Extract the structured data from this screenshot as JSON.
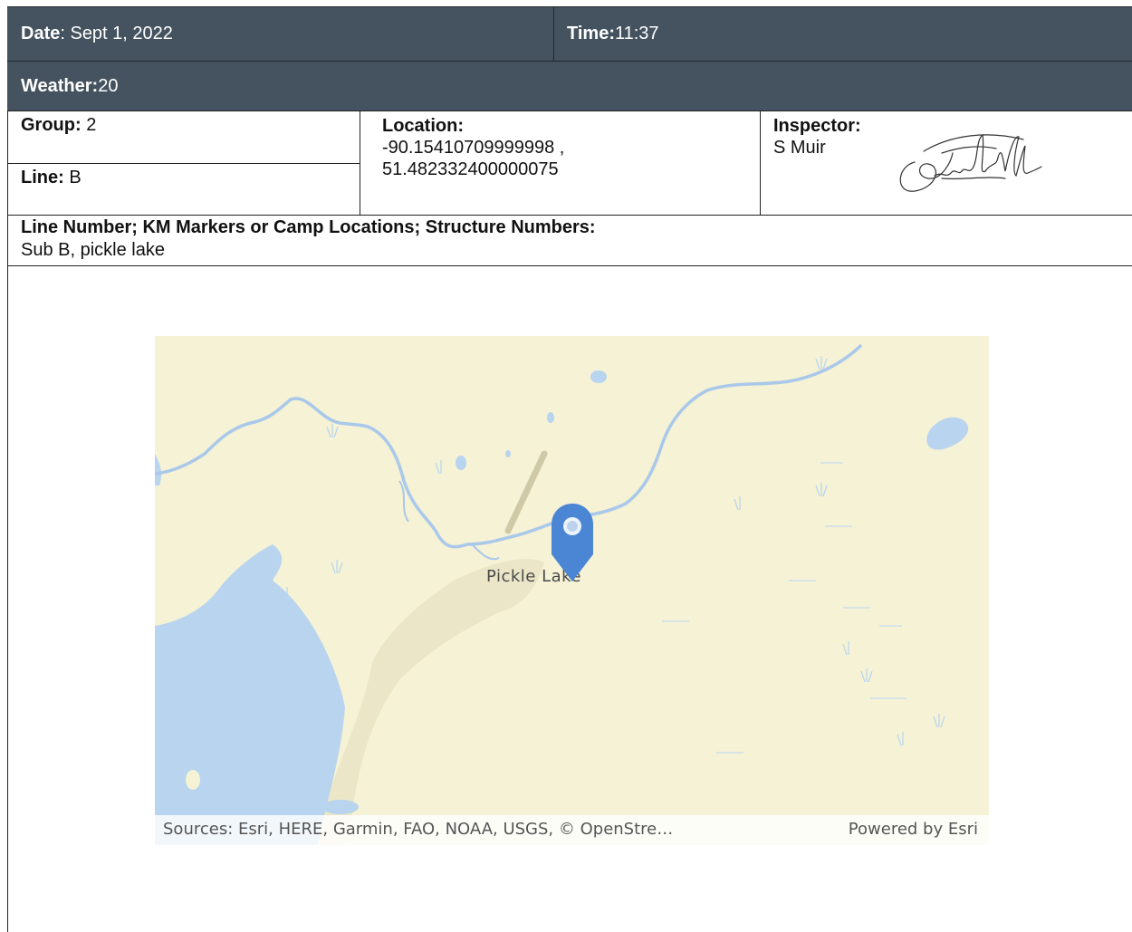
{
  "header": {
    "date_label": "Date",
    "date_value": ": Sept 1, 2022",
    "time_label": "Time:",
    "time_value": " 11:37",
    "weather_label": "Weather:",
    "weather_value": " 20"
  },
  "info": {
    "group_label": "Group:",
    "group_value": " 2",
    "line_label": "Line:",
    "line_value": " B",
    "location_label": "Location:",
    "location_line1": "-90.15410709999998 ,",
    "location_line2": "51.482332400000075",
    "inspector_label": "Inspector:",
    "inspector_value": "S Muir"
  },
  "line_section": {
    "heading": "Line Number; KM Markers or Camp Locations; Structure Numbers:",
    "value": "Sub B, pickle lake"
  },
  "map": {
    "place_label": "Pickle Lake",
    "attribution": "Sources: Esri, HERE, Garmin, FAO, NOAA, USGS, © OpenStre…",
    "powered_by": "Powered by Esri",
    "colors": {
      "land": "#f5f2d6",
      "water": "#b8d4ef",
      "pin": "#4a86d4"
    },
    "pin_icon": "map-pin-icon"
  }
}
